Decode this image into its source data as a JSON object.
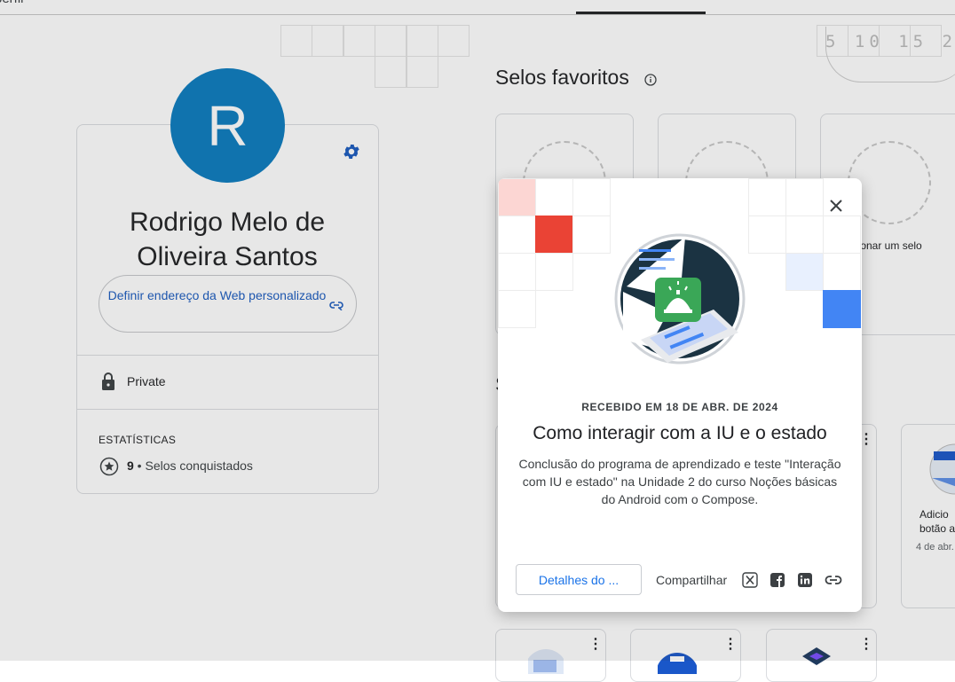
{
  "topbar": {
    "nav_text": "perfil"
  },
  "deco": {
    "numbers": "5 10 15 2"
  },
  "profile": {
    "avatar_letter": "R",
    "name": "Rodrigo Melo de Oliveira Santos",
    "custom_url_label": "Definir endereço da Web personalizado",
    "privacy": "Private",
    "stats_heading": "ESTATÍSTICAS",
    "stats_count": "9",
    "stats_suffix": " • Selos conquistados"
  },
  "favorites": {
    "title": "Selos favoritos",
    "add_slot_text": "icionar um selo"
  },
  "section2": {
    "partial_title": "S"
  },
  "right_card": {
    "line1": "Adicio",
    "line2": "botão a",
    "date": "4 de abr."
  },
  "modal": {
    "received": "RECEBIDO EM 18 DE ABR. DE 2024",
    "title": "Como interagir com a IU e o estado",
    "description": "Conclusão do programa de aprendizado e teste \"Interação com IU e estado\" na Unidade 2 do curso Noções básicas do Android com o Compose.",
    "details_button": "Detalhes do ...",
    "share_label": "Compartilhar"
  },
  "colors": {
    "avatar": "#0b7bbf",
    "link": "#1a5bbf",
    "accent_red": "#ea4335",
    "accent_blue": "#4285f4",
    "android_green": "#3aa757"
  },
  "icons": [
    "gear-icon",
    "link-icon",
    "lock-icon",
    "star-icon",
    "info-icon",
    "close-icon",
    "x-icon",
    "facebook-icon",
    "linkedin-icon",
    "link-share-icon"
  ]
}
